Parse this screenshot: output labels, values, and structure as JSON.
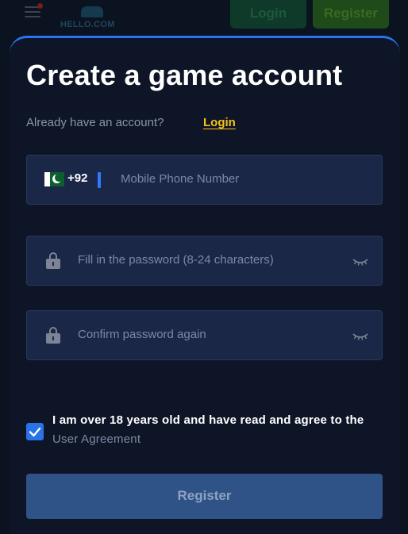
{
  "header": {
    "logo_text": "HELLO.COM",
    "login_label": "Login",
    "register_label": "Register"
  },
  "modal": {
    "title": "Create a game account",
    "already_text": "Already have an account?",
    "login_link": "Login",
    "phone": {
      "country_code": "+92",
      "placeholder": "Mobile Phone Number",
      "flag": "pakistan-flag"
    },
    "password": {
      "placeholder": "Fill in the password (8-24 characters)"
    },
    "confirm_password": {
      "placeholder": "Confirm password again"
    },
    "agreement": {
      "checked": true,
      "text_prefix": "I am over 18 years old and have read and agree to the ",
      "link_text": "User Agreement"
    },
    "register_button": "Register"
  },
  "colors": {
    "accent": "#2a73f0",
    "login_link": "#f7c21a",
    "field_bg": "#1b2747",
    "button_bg": "#2f5386",
    "background": "#0e1526"
  },
  "icons": [
    "menu-icon",
    "lock-icon",
    "eye-closed-icon",
    "check-icon",
    "pakistan-flag-icon"
  ]
}
